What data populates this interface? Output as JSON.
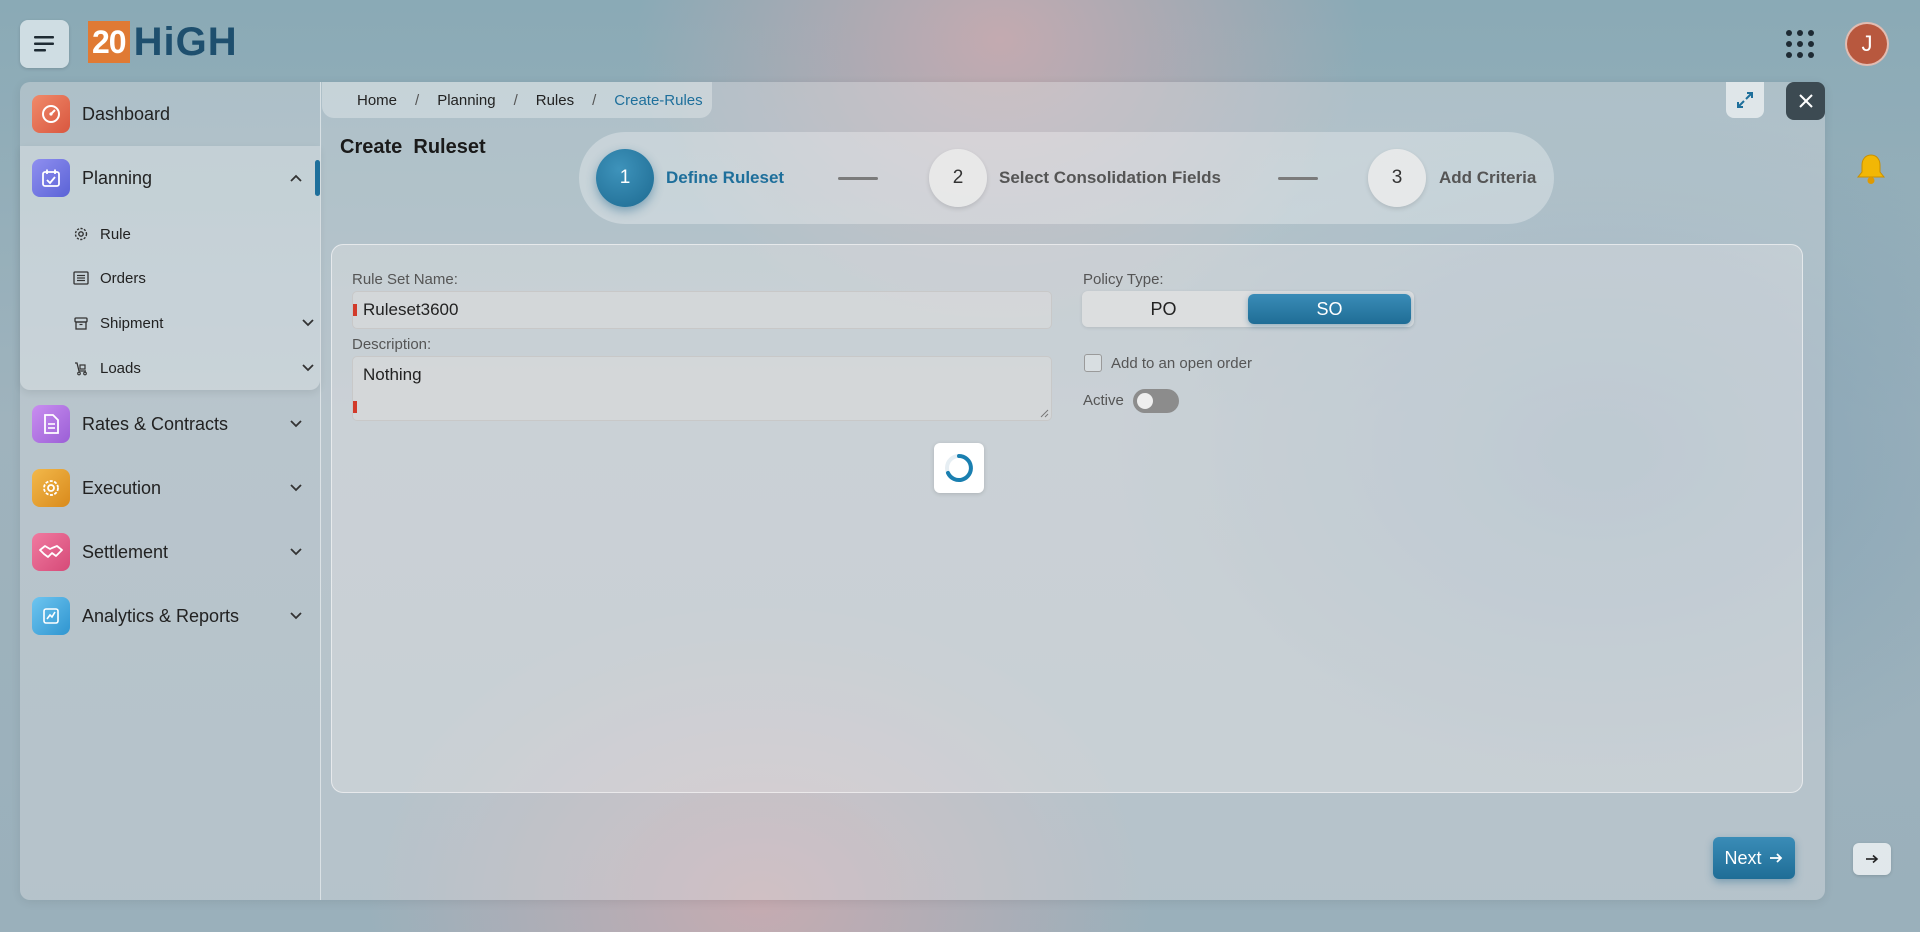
{
  "header": {
    "logo_number": "20",
    "logo_text": "HiGH",
    "avatar_initial": "J"
  },
  "breadcrumb": {
    "items": [
      "Home",
      "Planning",
      "Rules"
    ],
    "current": "Create-Rules",
    "separator": "/"
  },
  "sidebar": {
    "items": [
      {
        "label": "Dashboard",
        "icon": "dashboard-icon"
      },
      {
        "label": "Planning",
        "icon": "planning-icon",
        "expanded": true
      },
      {
        "label": "Rates & Contracts",
        "icon": "contracts-icon"
      },
      {
        "label": "Execution",
        "icon": "execution-icon"
      },
      {
        "label": "Settlement",
        "icon": "handshake-icon"
      },
      {
        "label": "Analytics & Reports",
        "icon": "analytics-icon"
      }
    ],
    "planning_sub": [
      {
        "label": "Rule",
        "icon": "gear-icon"
      },
      {
        "label": "Orders",
        "icon": "list-icon"
      },
      {
        "label": "Shipment",
        "icon": "box-icon"
      },
      {
        "label": "Loads",
        "icon": "truck-icon"
      }
    ]
  },
  "page": {
    "title": "Create  Ruleset"
  },
  "stepper": {
    "steps": [
      {
        "number": "1",
        "label": "Define Ruleset",
        "active": true
      },
      {
        "number": "2",
        "label": "Select Consolidation Fields",
        "active": false
      },
      {
        "number": "3",
        "label": "Add Criteria",
        "active": false
      }
    ]
  },
  "form": {
    "rule_set_name_label": "Rule Set Name:",
    "rule_set_name_value": "Ruleset3600",
    "description_label": "Description:",
    "description_value": "Nothing",
    "policy_type_label": "Policy Type:",
    "policy_options": [
      "PO",
      "SO"
    ],
    "policy_selected": "SO",
    "open_order_label": "Add to an open order",
    "open_order_checked": false,
    "active_label": "Active",
    "active_on": false
  },
  "actions": {
    "next_label": "Next"
  },
  "colors": {
    "accent": "#1e6f9b",
    "logo_orange": "#e07a34",
    "logo_navy": "#1e4f6e",
    "required": "#d23a2a",
    "bell": "#f2b705"
  }
}
